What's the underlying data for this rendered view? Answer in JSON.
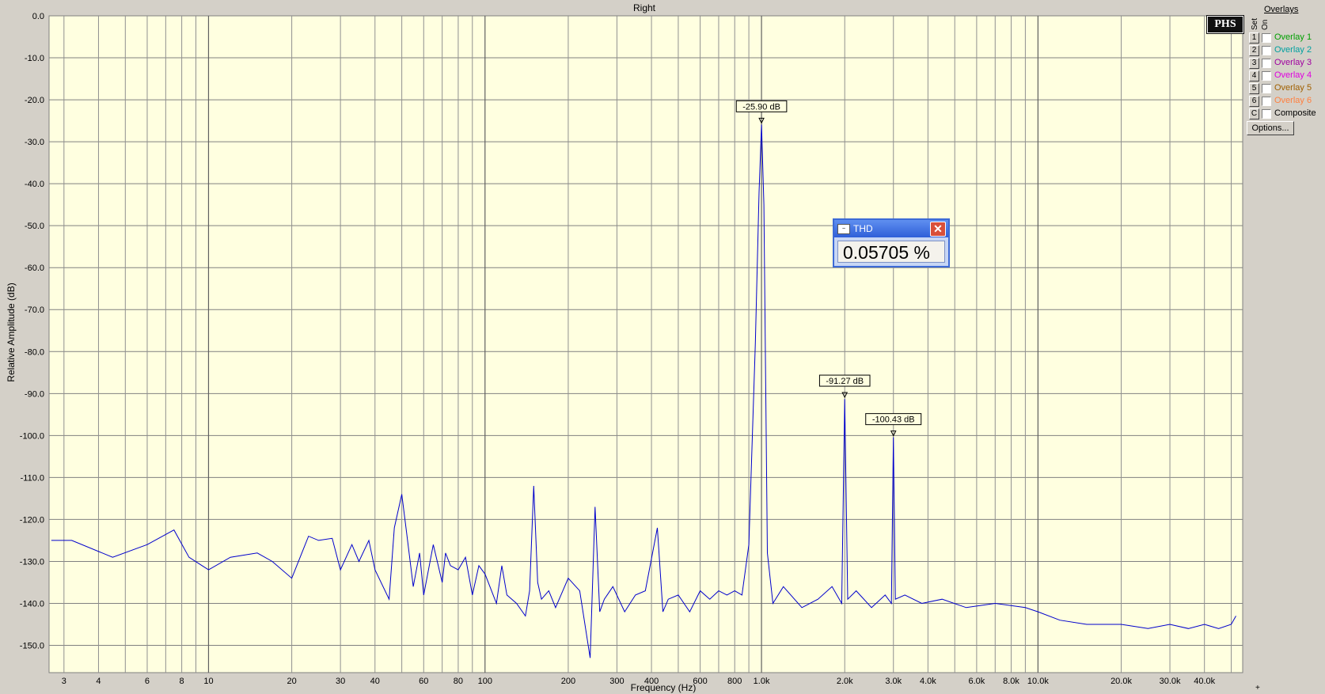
{
  "window": {
    "title": "Right"
  },
  "overlays": {
    "title": "Overlays",
    "col_set": "Set",
    "col_on": "On",
    "items": [
      {
        "num": "1",
        "label": "Overlay 1",
        "color": "#00a000"
      },
      {
        "num": "2",
        "label": "Overlay 2",
        "color": "#00a0a0"
      },
      {
        "num": "3",
        "label": "Overlay 3",
        "color": "#a000a0"
      },
      {
        "num": "4",
        "label": "Overlay 4",
        "color": "#e000e0"
      },
      {
        "num": "5",
        "label": "Overlay 5",
        "color": "#a06000"
      },
      {
        "num": "6",
        "label": "Overlay 6",
        "color": "#ff8040"
      },
      {
        "num": "C",
        "label": "Composite",
        "color": "#000000"
      }
    ],
    "options_label": "Options..."
  },
  "logo_text": "PHS",
  "thd_window": {
    "title": "THD",
    "icon": "waveform-icon",
    "value": "0.05705 %"
  },
  "corner_glyph": "+",
  "chart_data": {
    "type": "line",
    "title": "Right",
    "xlabel": "Frequency (Hz)",
    "ylabel": "Relative Amplitude (dB)",
    "x_scale": "log",
    "xlim": [
      2.65,
      55000
    ],
    "ylim": [
      -156.5,
      0
    ],
    "y_ticks": [
      0,
      -10,
      -20,
      -30,
      -40,
      -50,
      -60,
      -70,
      -80,
      -90,
      -100,
      -110,
      -120,
      -130,
      -140,
      -150
    ],
    "y_tick_labels": [
      "0.0",
      "-10.0",
      "-20.0",
      "-30.0",
      "-40.0",
      "-50.0",
      "-60.0",
      "-70.0",
      "-80.0",
      "-90.0",
      "-100.0",
      "-110.0",
      "-120.0",
      "-130.0",
      "-140.0",
      "-150.0"
    ],
    "x_ticks": [
      3,
      4,
      6,
      8,
      10,
      20,
      30,
      40,
      60,
      80,
      100,
      200,
      300,
      400,
      600,
      800,
      1000,
      2000,
      3000,
      4000,
      6000,
      8000,
      10000,
      20000,
      30000,
      40000
    ],
    "x_tick_labels": [
      "3",
      "4",
      "6",
      "8",
      "10",
      "20",
      "30",
      "40",
      "60",
      "80",
      "100",
      "200",
      "300",
      "400",
      "600",
      "800",
      "1.0k",
      "2.0k",
      "3.0k",
      "4.0k",
      "6.0k",
      "8.0k",
      "10.0k",
      "20.0k",
      "30.0k",
      "40.0k"
    ],
    "grid": true,
    "background": "#ffffe0",
    "line_color": "#0000cc",
    "series": [
      {
        "x": [
          2.7,
          3.2,
          4.5,
          6.0,
          7.5,
          8.5,
          10,
          12,
          15,
          17,
          20,
          23,
          25,
          28,
          30,
          33,
          35,
          38,
          40,
          45,
          47,
          50,
          52,
          55,
          58,
          60,
          65,
          70,
          72,
          75,
          80,
          85,
          90,
          95,
          100,
          110,
          115,
          120,
          130,
          140,
          145,
          150,
          155,
          160,
          170,
          180,
          200,
          220,
          240,
          250,
          260,
          270,
          290,
          320,
          350,
          380,
          420,
          440,
          460,
          500,
          550,
          600,
          650,
          700,
          750,
          800,
          850,
          900,
          950,
          980,
          1000,
          1020,
          1050,
          1100,
          1200,
          1400,
          1600,
          1800,
          1950,
          2000,
          2050,
          2200,
          2500,
          2800,
          2950,
          3000,
          3050,
          3300,
          3800,
          4500,
          5500,
          7000,
          9000,
          10000,
          12000,
          15000,
          20000,
          25000,
          30000,
          35000,
          40000,
          45000,
          50000,
          52000
        ],
        "y": [
          -125,
          -125,
          -129,
          -126,
          -122.5,
          -129,
          -132,
          -129,
          -128,
          -130,
          -134,
          -124,
          -125,
          -124.5,
          -132,
          -126,
          -130,
          -125,
          -132,
          -139,
          -122,
          -114,
          -123,
          -136,
          -128,
          -138,
          -126,
          -135,
          -128,
          -131,
          -132,
          -129,
          -138,
          -131,
          -133,
          -140,
          -131,
          -138,
          -140,
          -143,
          -137,
          -112,
          -135,
          -139,
          -137,
          -141,
          -134,
          -137,
          -153,
          -117,
          -142,
          -139,
          -136,
          -142,
          -138,
          -137,
          -122,
          -142,
          -139,
          -138,
          -142,
          -137,
          -139,
          -137,
          -138,
          -137,
          -138,
          -126,
          -78,
          -42,
          -25.9,
          -45,
          -128,
          -140,
          -136,
          -141,
          -139,
          -136,
          -140,
          -91.3,
          -139,
          -137,
          -141,
          -138,
          -140,
          -100.4,
          -139,
          -138,
          -140,
          -139,
          -141,
          -140,
          -141,
          -142,
          -144,
          -145,
          -145,
          -146,
          -145,
          -146,
          -145,
          -146,
          -145,
          -143
        ]
      }
    ],
    "annotations": [
      {
        "x": 1000,
        "y": -25.9,
        "text": "-25.90 dB"
      },
      {
        "x": 2000,
        "y": -91.27,
        "text": "-91.27 dB"
      },
      {
        "x": 3000,
        "y": -100.43,
        "text": "-100.43 dB"
      }
    ]
  }
}
